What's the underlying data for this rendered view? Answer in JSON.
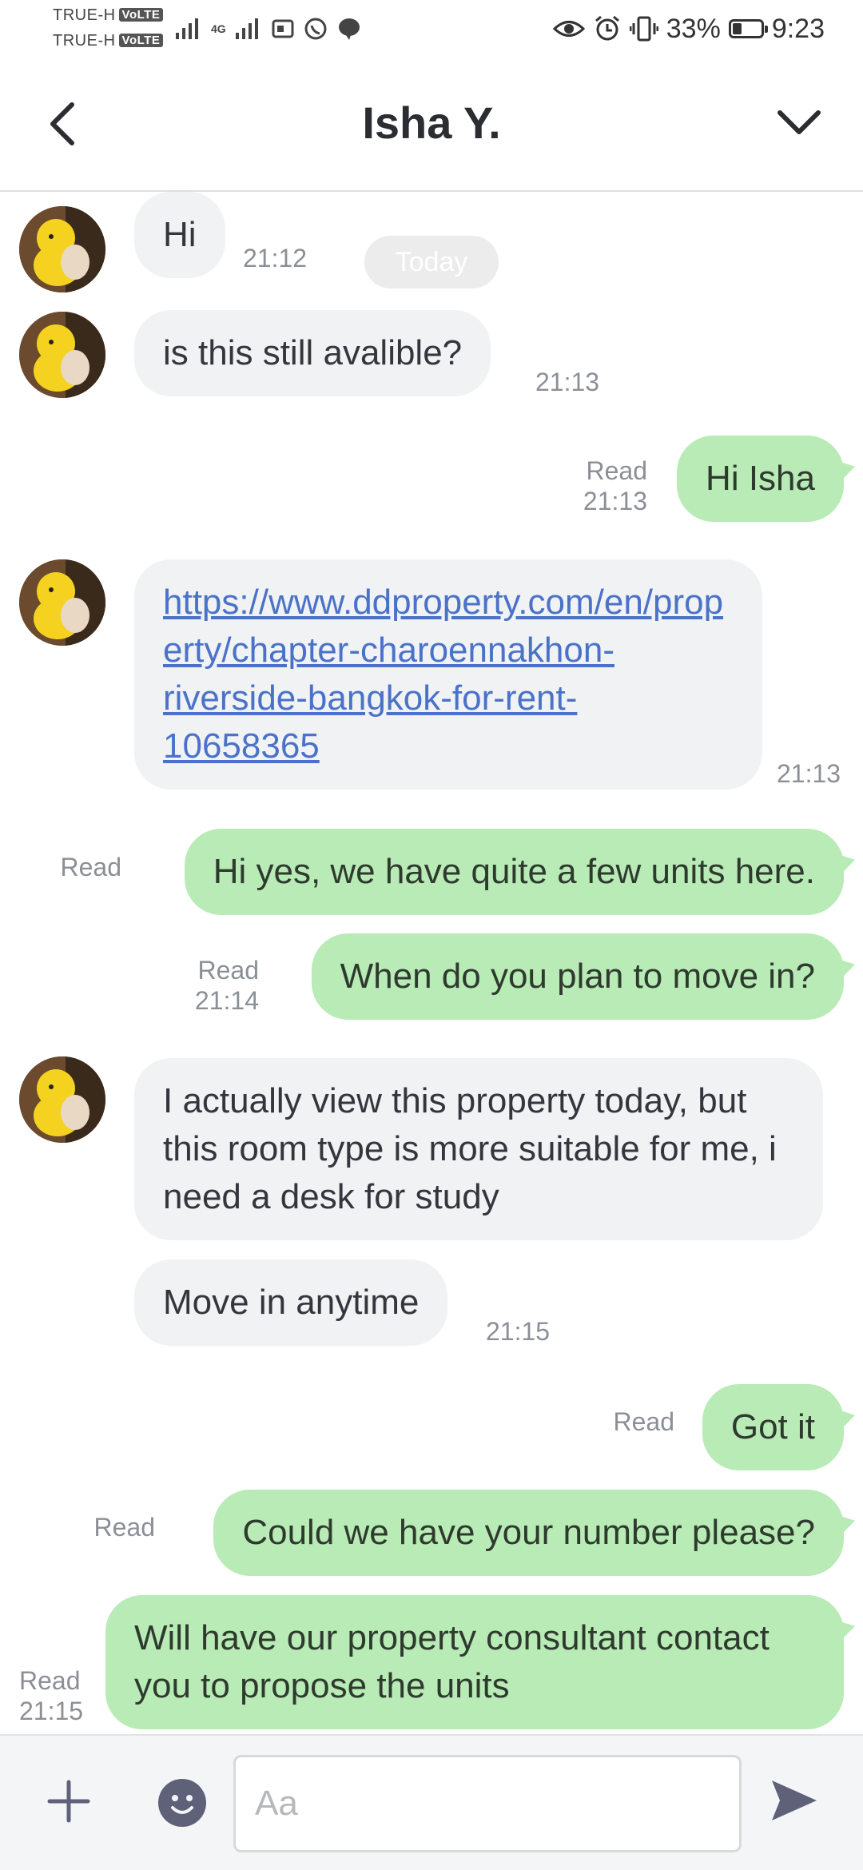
{
  "status_bar": {
    "carrier1": "TRUE-H",
    "carrier2": "TRUE-H",
    "volte": "VoLTE",
    "network": "4G",
    "battery": "33%",
    "battery_level": 0.33,
    "time": "9:23"
  },
  "header": {
    "title": "Isha Y."
  },
  "date_divider": "Today",
  "messages": [
    {
      "text": "Hi",
      "time": "21:12"
    },
    {
      "text": "is this still avalible?",
      "time": "21:13"
    },
    {
      "text": "Hi Isha",
      "read": "Read",
      "time": "21:13"
    },
    {
      "text": "https://www.ddproperty.com/en/property/chapter-charoennakhon-riverside-bangkok-for-rent-10658365",
      "time": "21:13"
    },
    {
      "text": "Hi yes, we have quite a few units here.",
      "read": "Read"
    },
    {
      "text": "When do you plan to move in?",
      "read": "Read",
      "time": "21:14"
    },
    {
      "text": "I actually view this property today, but this room type is more suitable for me, i need a desk for study"
    },
    {
      "text": "Move in anytime",
      "time": "21:15"
    },
    {
      "text": "Got it",
      "read": "Read"
    },
    {
      "text": "Could we have your number please?",
      "read": "Read"
    },
    {
      "text": "Will have our property consultant contact you to propose the units",
      "read": "Read",
      "time": "21:15"
    }
  ],
  "input": {
    "placeholder": "Aa",
    "value": ""
  },
  "colors": {
    "incoming": "#f1f2f4",
    "outgoing": "#b8ebb5",
    "link": "#4a72c8"
  },
  "icons": [
    "back-icon",
    "chevron-down-icon",
    "plus-icon",
    "emoji-icon",
    "send-icon"
  ]
}
